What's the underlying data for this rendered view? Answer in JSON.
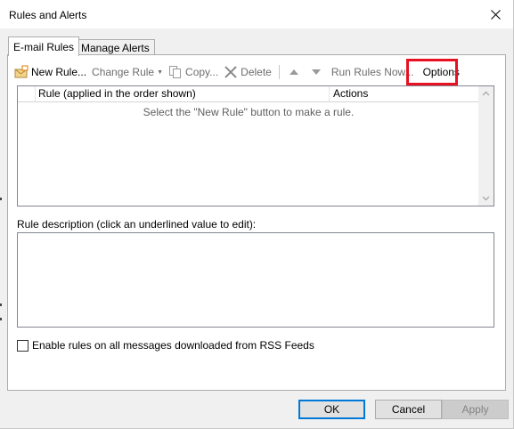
{
  "window": {
    "title": "Rules and Alerts"
  },
  "tabs": [
    {
      "label": "E-mail Rules",
      "active": true
    },
    {
      "label": "Manage Alerts",
      "active": false
    }
  ],
  "toolbar": {
    "new_rule": "New Rule...",
    "change_rule": "Change Rule",
    "copy": "Copy...",
    "delete": "Delete",
    "run_rules_now": "Run Rules Now...",
    "options": "Options"
  },
  "rules_table": {
    "columns": [
      "Rule (applied in the order shown)",
      "Actions"
    ],
    "empty_message": "Select the \"New Rule\" button to make a rule."
  },
  "description": {
    "label": "Rule description (click an underlined value to edit):"
  },
  "rss": {
    "label": "Enable rules on all messages downloaded from RSS Feeds",
    "checked": false
  },
  "buttons": {
    "ok": "OK",
    "cancel": "Cancel",
    "apply": "Apply"
  },
  "colors": {
    "highlight": "#e81123",
    "default_button_border": "#0078d7"
  }
}
